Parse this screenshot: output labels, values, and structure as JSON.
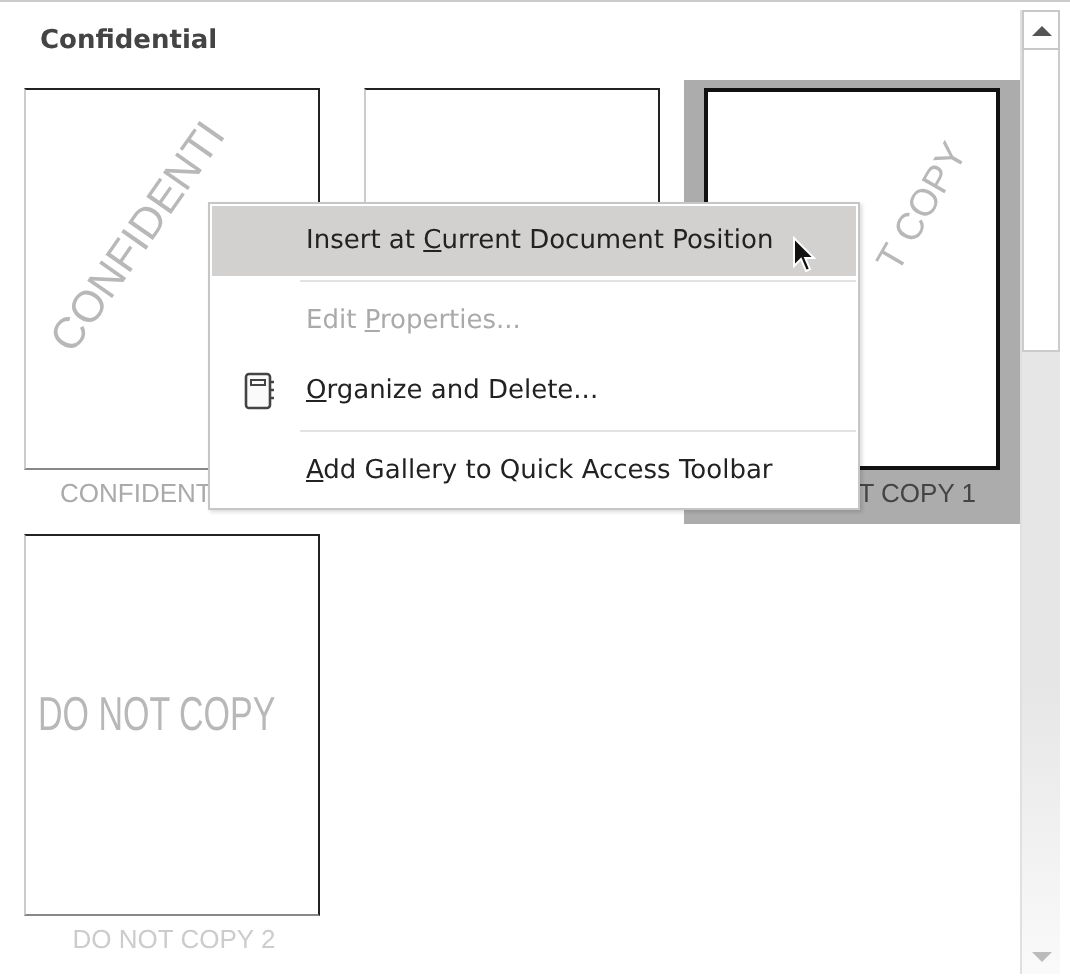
{
  "gallery": {
    "heading": "Confidential",
    "items": [
      {
        "watermark": "CONFIDENTI",
        "label": "CONFIDENT",
        "selected": false
      },
      {
        "selected": false
      },
      {
        "watermark": "T COPY",
        "label": "T COPY 1",
        "selected": true
      },
      {
        "watermark": "DO NOT COPY",
        "label": "DO NOT COPY 2",
        "selected": false
      }
    ]
  },
  "context_menu": {
    "items": [
      {
        "kind": "item",
        "before": "Insert at ",
        "accel": "C",
        "after": "urrent Document Position",
        "highlighted": true,
        "disabled": false
      },
      {
        "kind": "separator"
      },
      {
        "kind": "item",
        "before": "Edit ",
        "accel": "P",
        "after": "roperties...",
        "highlighted": false,
        "disabled": true
      },
      {
        "kind": "icon_item",
        "accel": "O",
        "after": "rganize and Delete...",
        "highlighted": false,
        "disabled": false
      },
      {
        "kind": "separator"
      },
      {
        "kind": "item",
        "accel": "A",
        "after": "dd Gallery to Quick Access Toolbar",
        "highlighted": false,
        "disabled": false
      }
    ]
  }
}
